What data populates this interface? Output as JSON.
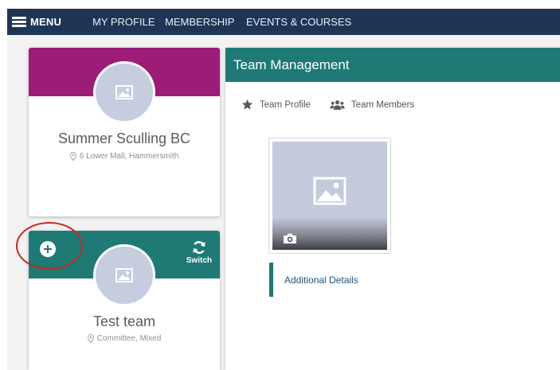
{
  "nav": {
    "menu_label": "MENU",
    "links": [
      "MY PROFILE",
      "MEMBERSHIP",
      "EVENTS & COURSES"
    ]
  },
  "club_card": {
    "name": "Summer Sculling BC",
    "location": "6 Lower Mall, Hammersmith",
    "banner_color": "#9b1d77"
  },
  "team_card": {
    "name": "Test team",
    "details": "Committee, Mixed",
    "switch_label": "Switch",
    "banner_color": "#1f7a76"
  },
  "team_management": {
    "title": "Team Management",
    "tabs": [
      {
        "label": "Team Profile",
        "icon": "star-icon"
      },
      {
        "label": "Team Members",
        "icon": "people-icon"
      }
    ],
    "additional_details_label": "Additional Details"
  },
  "colors": {
    "nav_bg": "#1f3556",
    "teal": "#1f7a76",
    "annotation": "#c8281f"
  }
}
